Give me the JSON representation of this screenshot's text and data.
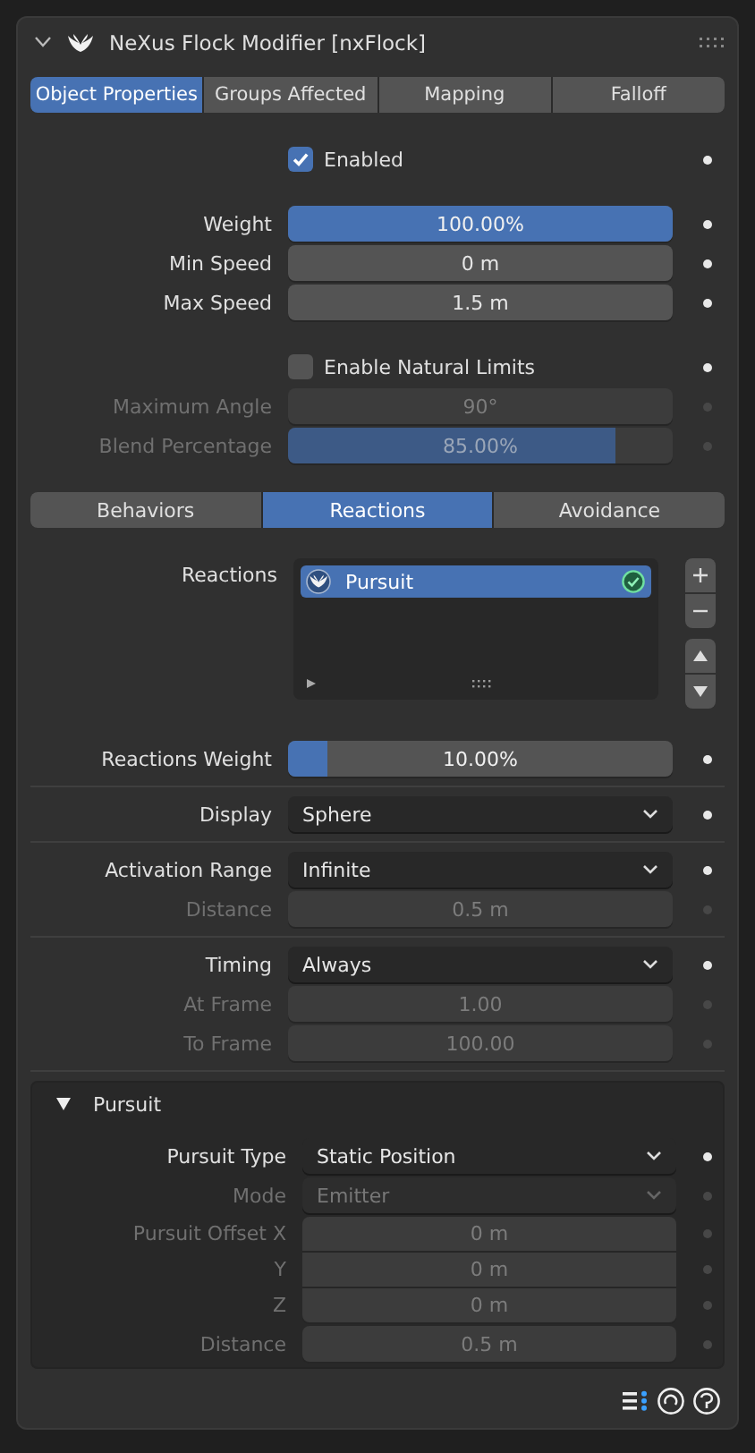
{
  "modifier": {
    "title": "NeXus Flock Modifier [nxFlock]",
    "expanded": true
  },
  "tabs": [
    {
      "label": "Object Properties",
      "selected": true
    },
    {
      "label": "Groups Affected",
      "selected": false
    },
    {
      "label": "Mapping",
      "selected": false
    },
    {
      "label": "Falloff",
      "selected": false
    }
  ],
  "property_groups": [
    {
      "rows": [
        {
          "kind": "checkbox",
          "label": "Enabled",
          "checked": true,
          "disabled": false
        }
      ]
    },
    {
      "rows": [
        {
          "kind": "slider",
          "label": "Weight",
          "value": "100.00%",
          "level": 1.0,
          "disabled": false
        },
        {
          "kind": "number",
          "label": "Min Speed",
          "value": "0 m",
          "disabled": false
        },
        {
          "kind": "number",
          "label": "Max Speed",
          "value": "1.5 m",
          "disabled": false
        }
      ]
    },
    {
      "rows": [
        {
          "kind": "checkbox",
          "label": "Enable Natural Limits",
          "checked": false,
          "disabled": false
        },
        {
          "kind": "number",
          "label": "Maximum Angle",
          "value": "90°",
          "disabled": true
        },
        {
          "kind": "slider",
          "label": "Blend Percentage",
          "value": "85.00%",
          "level": 0.85,
          "disabled": true
        }
      ]
    }
  ],
  "behavior_tabs": [
    {
      "label": "Behaviors",
      "selected": false
    },
    {
      "label": "Reactions",
      "selected": true
    },
    {
      "label": "Avoidance",
      "selected": false
    }
  ],
  "reactions": {
    "label": "Reactions",
    "items": [
      {
        "name": "Pursuit",
        "selected": true,
        "enabled": true
      }
    ]
  },
  "reaction_groups": [
    {
      "rows": [
        {
          "kind": "slider",
          "label": "Reactions Weight",
          "value": "10.00%",
          "level": 0.1,
          "disabled": false
        }
      ]
    },
    {
      "rows": [
        {
          "kind": "dropdown",
          "label": "Display",
          "value": "Sphere",
          "disabled": false
        }
      ]
    },
    {
      "rows": [
        {
          "kind": "dropdown",
          "label": "Activation Range",
          "value": "Infinite",
          "disabled": false
        },
        {
          "kind": "number",
          "label": "Distance",
          "value": "0.5 m",
          "disabled": true
        }
      ]
    },
    {
      "rows": [
        {
          "kind": "dropdown",
          "label": "Timing",
          "value": "Always",
          "disabled": false
        },
        {
          "kind": "number",
          "label": "At Frame",
          "value": "1.00",
          "disabled": true
        },
        {
          "kind": "number",
          "label": "To Frame",
          "value": "100.00",
          "disabled": true
        }
      ]
    }
  ],
  "subpanel": {
    "title": "Pursuit",
    "expanded": true,
    "rows": [
      {
        "kind": "dropdown",
        "label": "Pursuit Type",
        "value": "Static Position",
        "disabled": false
      },
      {
        "kind": "dropdown",
        "label": "Mode",
        "value": "Emitter",
        "disabled": true
      },
      {
        "kind": "vector",
        "labels": [
          "Pursuit Offset X",
          "Y",
          "Z"
        ],
        "values": [
          "0 m",
          "0 m",
          "0 m"
        ],
        "disabled": true
      },
      {
        "kind": "number",
        "label": "Distance",
        "value": "0.5 m",
        "disabled": true
      }
    ]
  }
}
